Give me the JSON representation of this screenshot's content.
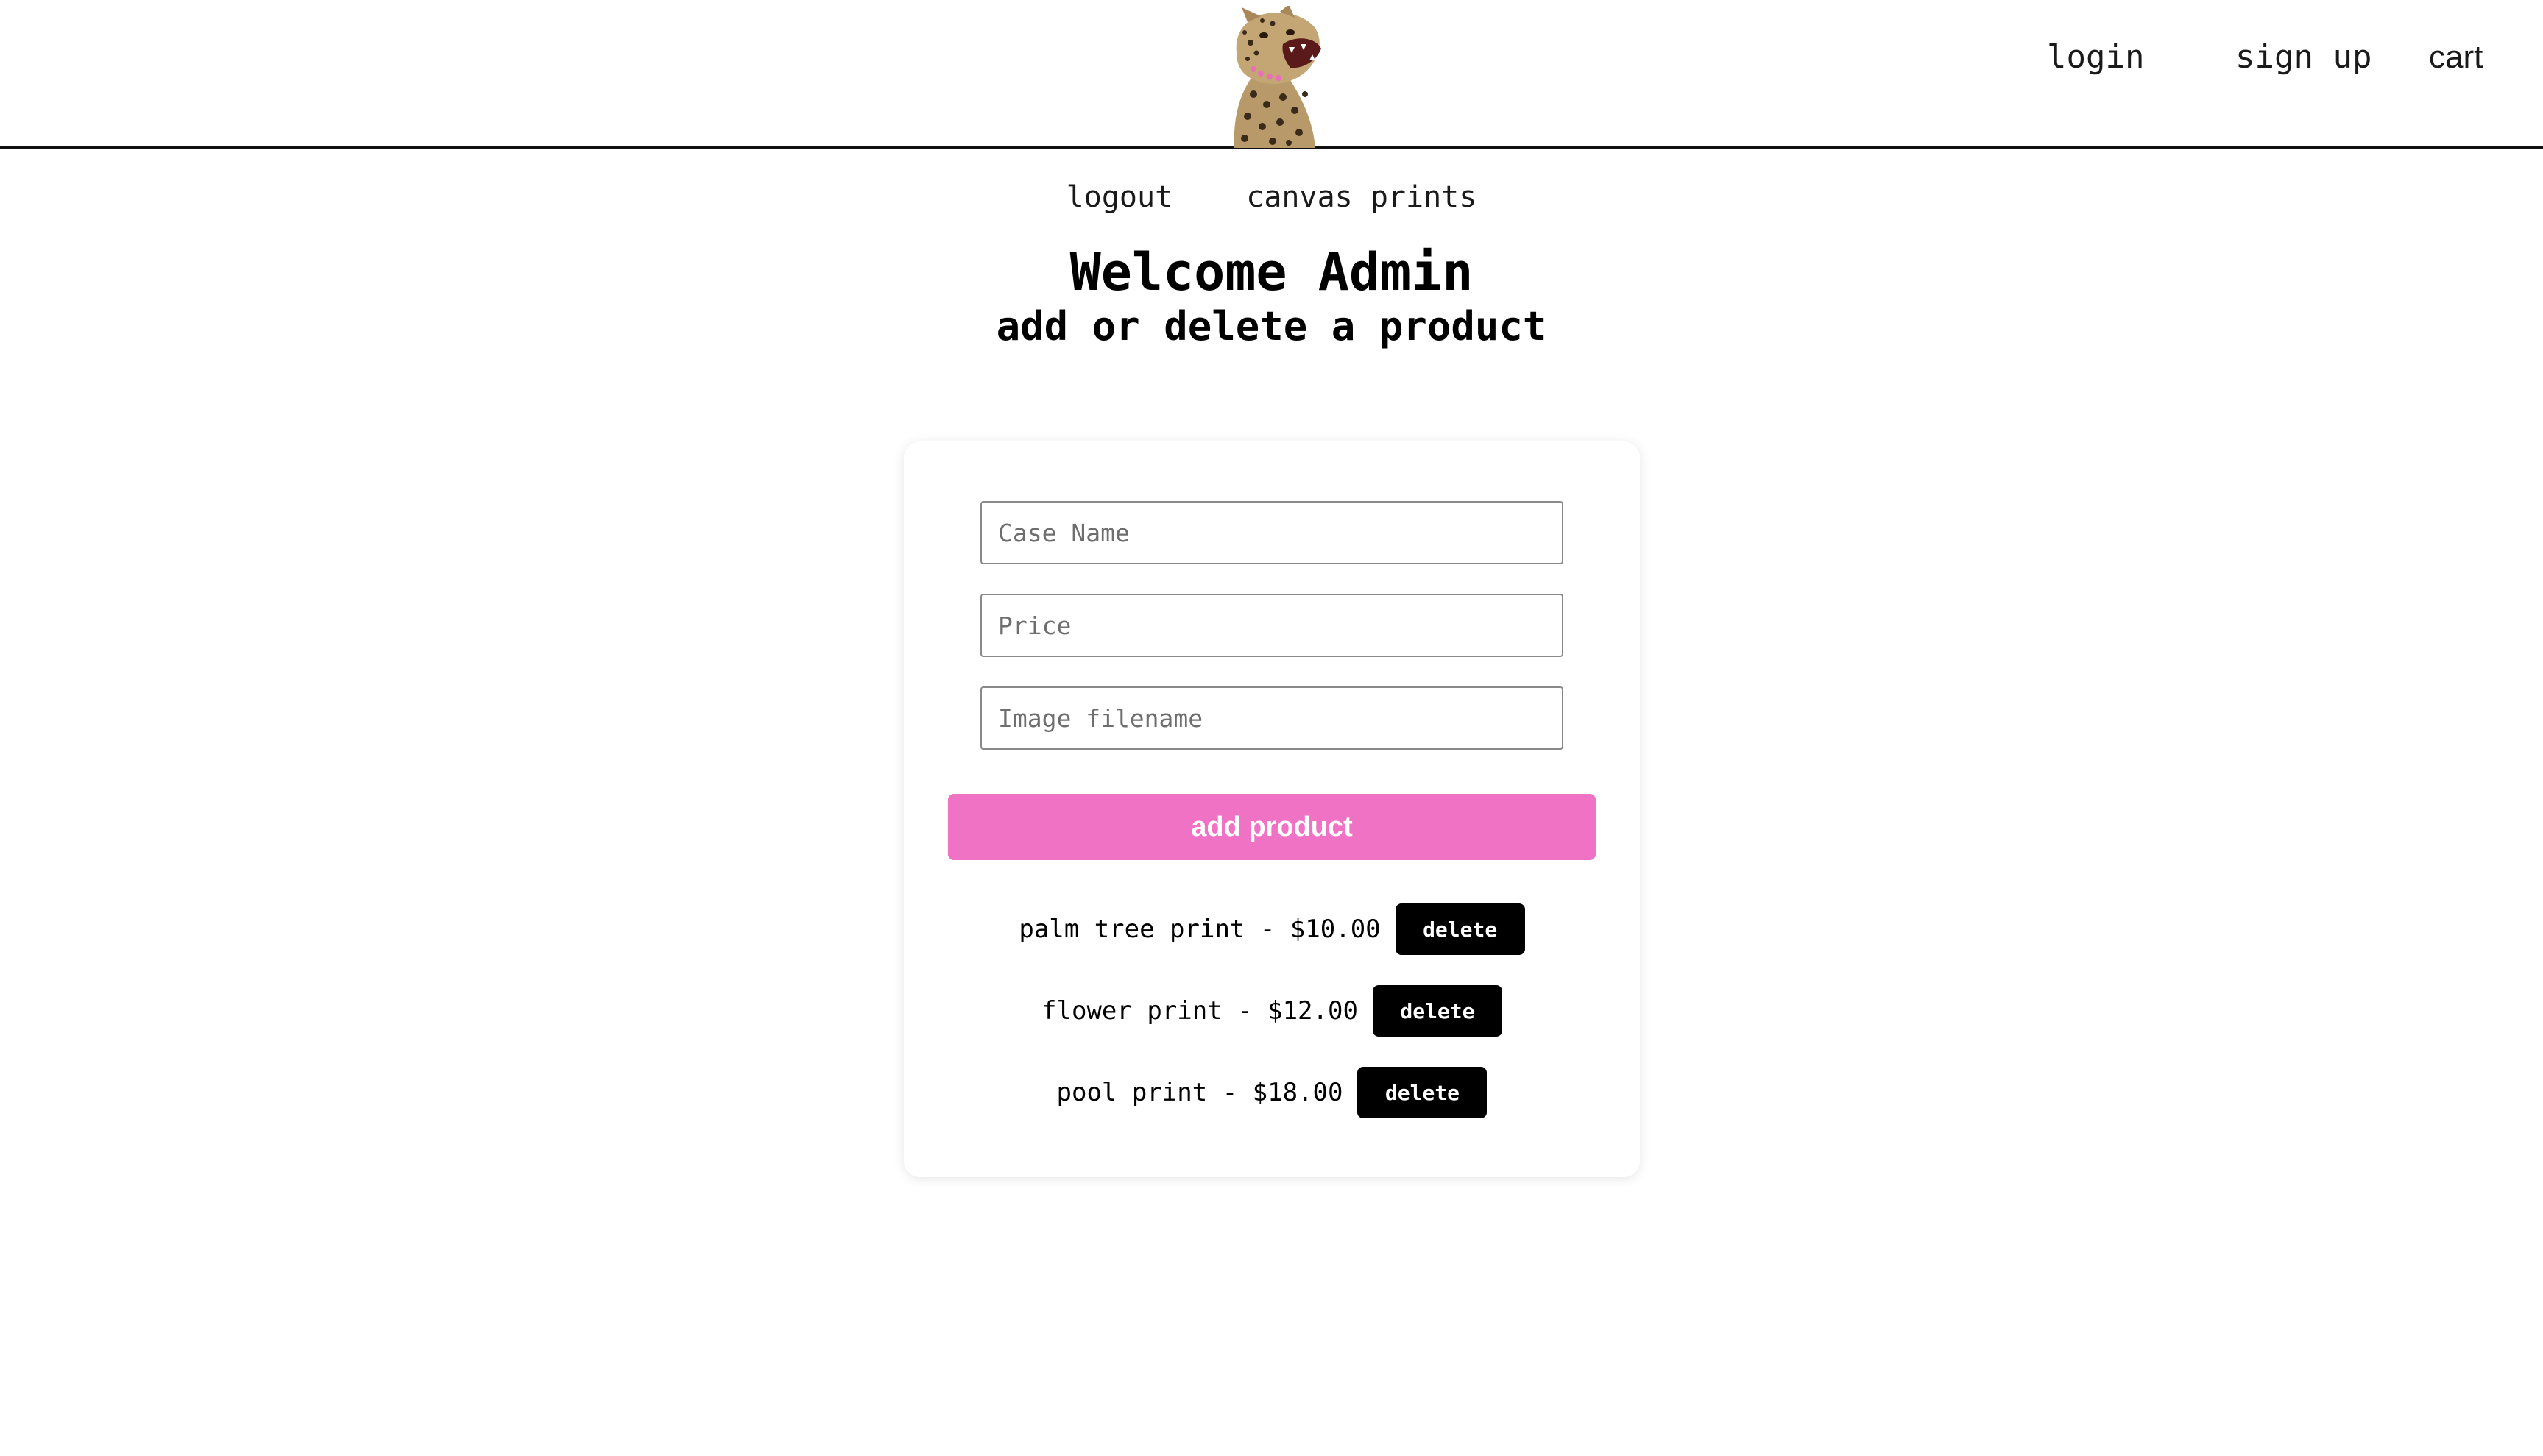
{
  "header": {
    "logo_icon": "leopard-logo",
    "nav": {
      "login": "login",
      "signup": "sign up",
      "cart": "cart"
    }
  },
  "subnav": {
    "logout": "logout",
    "canvas_prints": "canvas prints"
  },
  "page": {
    "title": "Welcome Admin",
    "subtitle": "add or delete a product"
  },
  "form": {
    "case_name": {
      "placeholder": "Case Name",
      "value": ""
    },
    "price": {
      "placeholder": "Price",
      "value": ""
    },
    "image_filename": {
      "placeholder": "Image filename",
      "value": ""
    },
    "submit_label": "add product"
  },
  "products": [
    {
      "name": "palm tree print",
      "price": "$10.00",
      "delete_label": "delete"
    },
    {
      "name": "flower print",
      "price": "$12.00",
      "delete_label": "delete"
    },
    {
      "name": "pool print",
      "price": "$18.00",
      "delete_label": "delete"
    }
  ],
  "colors": {
    "accent": "#ef72c4",
    "button_dark": "#000000",
    "header_rule": "#111111"
  }
}
